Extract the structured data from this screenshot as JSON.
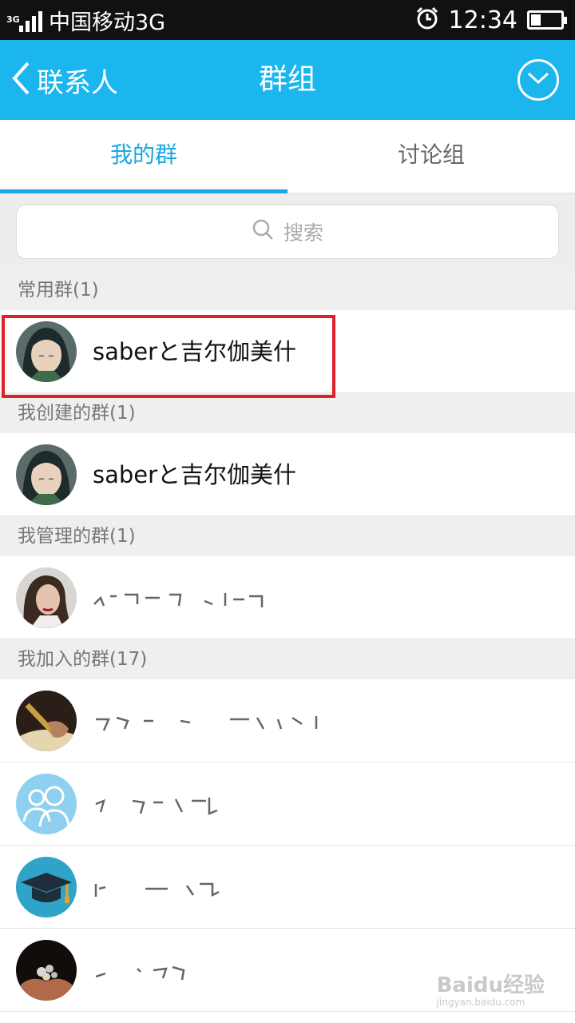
{
  "status_bar": {
    "network_type": "3G",
    "carrier": "中国移动3G",
    "time": "12:34",
    "icons": [
      "signal-icon",
      "alarm-icon",
      "battery-icon"
    ]
  },
  "title_bar": {
    "back_label": "联系人",
    "title": "群组",
    "menu_icon": "chevron-down-circle-icon",
    "background_color": "#1bb6ee"
  },
  "tabs": [
    {
      "label": "我的群",
      "active": true
    },
    {
      "label": "讨论组",
      "active": false
    }
  ],
  "accent_color": "#1aa7e2",
  "search": {
    "placeholder": "搜索"
  },
  "sections": [
    {
      "header": "常用群(1)",
      "items": [
        {
          "name": "saberと吉尔伽美什",
          "avatar": "anime-girl-avatar",
          "highlighted": true
        }
      ]
    },
    {
      "header": "我创建的群(1)",
      "items": [
        {
          "name": "saberと吉尔伽美什",
          "avatar": "anime-girl-avatar"
        }
      ]
    },
    {
      "header": "我管理的群(1)",
      "items": [
        {
          "name": "",
          "avatar": "woman-portrait-avatar",
          "redacted": true
        }
      ]
    },
    {
      "header": "我加入的群(17)",
      "items": [
        {
          "name": "",
          "avatar": "pen-writing-avatar",
          "redacted": true
        },
        {
          "name": "",
          "avatar": "people-group-avatar",
          "redacted": true
        },
        {
          "name": "",
          "avatar": "graduation-cap-avatar",
          "redacted": true
        },
        {
          "name": "",
          "avatar": "hands-coins-avatar",
          "redacted": true
        }
      ]
    }
  ],
  "highlight_color": "#e0202a",
  "watermark": {
    "main": "Baidu经验",
    "sub": "jingyan.baidu.com"
  }
}
